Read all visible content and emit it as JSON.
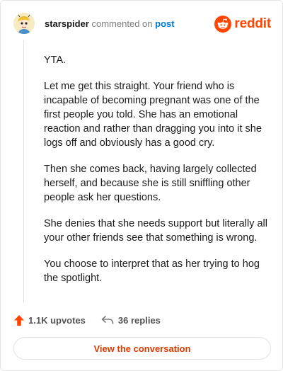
{
  "header": {
    "username": "starspider",
    "commented_text": "commented on",
    "post_link": "post",
    "brand": "reddit"
  },
  "comment": {
    "paragraphs": [
      "YTA.",
      "Let me get this straight. Your friend who is incapable of becoming pregnant was one of the first people you told. She has an emotional reaction and rather than dragging you into it she logs off and obviously has a good cry.",
      "Then she comes back, having largely collected herself, and because she is still sniffling other people ask her questions.",
      "She denies that she needs support but literally all your other friends see that something is wrong.",
      "You choose to interpret that as her trying to hog the spotlight."
    ]
  },
  "footer": {
    "upvotes": "1.1K upvotes",
    "replies": "36 replies",
    "view_button": "View the conversation"
  },
  "colors": {
    "brand": "#ff4500",
    "link": "#0079d3",
    "button_text": "#d93a00"
  },
  "icons": {
    "brand": "reddit-snoo-icon",
    "upvote": "upvote-arrow-icon",
    "reply": "reply-arrow-icon"
  }
}
